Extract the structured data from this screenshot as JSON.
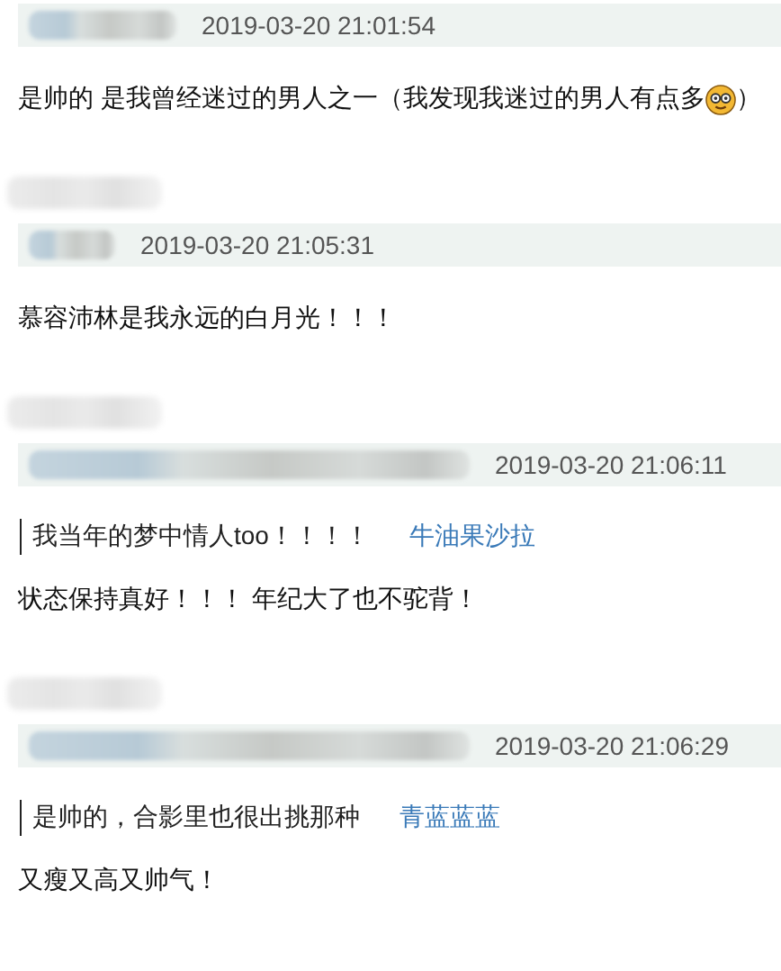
{
  "comments": [
    {
      "time": "2019-03-20 21:01:54",
      "parts": [
        {
          "kind": "text",
          "text": "是帅的 是我曾经迷过的男人之一（我发现我迷过的男人有点多"
        },
        {
          "kind": "emoji"
        },
        {
          "kind": "text",
          "text": "）"
        }
      ]
    },
    {
      "time": "2019-03-20 21:05:31",
      "parts": [
        {
          "kind": "text",
          "text": "慕容沛林是我永远的白月光！！！"
        }
      ]
    },
    {
      "time": "2019-03-20 21:06:11",
      "quote": {
        "text": "我当年的梦中情人too！！！！",
        "author": "牛油果沙拉"
      },
      "parts": [
        {
          "kind": "text",
          "text": "状态保持真好！！！ 年纪大了也不驼背！"
        }
      ]
    },
    {
      "time": "2019-03-20 21:06:29",
      "quote": {
        "text": "是帅的，合影里也很出挑那种",
        "author": "青蓝蓝蓝"
      },
      "parts": [
        {
          "kind": "text",
          "text": "又瘦又高又帅气！"
        }
      ]
    }
  ]
}
